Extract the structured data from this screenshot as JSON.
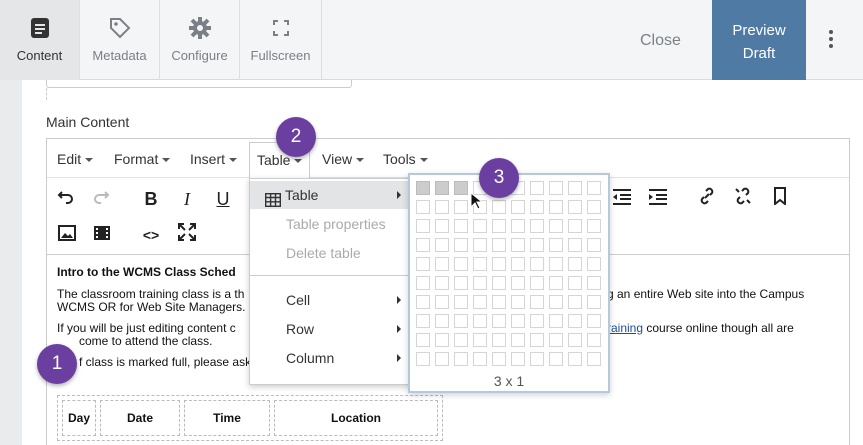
{
  "topbar": {
    "tabs": [
      {
        "label": "Content",
        "icon": "document-icon"
      },
      {
        "label": "Metadata",
        "icon": "tag-icon"
      },
      {
        "label": "Configure",
        "icon": "gear-icon"
      },
      {
        "label": "Fullscreen",
        "icon": "fullscreen-icon"
      }
    ],
    "close_label": "Close",
    "preview_label": "Preview Draft"
  },
  "colors": {
    "accent": "#4f7aa3",
    "callout": "#6b3fa0",
    "highlight": "#e2e4e6"
  },
  "editor": {
    "section_label": "Main Content",
    "menus": [
      "Edit",
      "Format",
      "Insert",
      "Table",
      "View",
      "Tools"
    ],
    "content": {
      "heading": "Intro to the WCMS Class Sched",
      "line1a": "The classroom training class is a th",
      "line1b": "g an entire Web site into the Campus",
      "line2": "WCMS OR for Web Site Managers.",
      "line3a": "If you will be just editing content c",
      "link": "r Training",
      "line3b": " course online though all are",
      "line4": "come to attend the class.",
      "line5": "f class is marked full, please ask to be put on the waiting lis"
    },
    "table_headers": [
      "Day",
      "Date",
      "Time",
      "Location"
    ]
  },
  "table_menu": {
    "items": [
      {
        "label": "Table",
        "state": "highlighted",
        "submenu": true
      },
      {
        "label": "Table properties",
        "state": "disabled",
        "submenu": false
      },
      {
        "label": "Delete table",
        "state": "disabled",
        "submenu": false
      },
      {
        "label": "Cell",
        "state": "normal",
        "submenu": true
      },
      {
        "label": "Row",
        "state": "normal",
        "submenu": true
      },
      {
        "label": "Column",
        "state": "normal",
        "submenu": true
      }
    ]
  },
  "grid_picker": {
    "rows": 10,
    "cols": 10,
    "selected_cols": 3,
    "selected_rows": 1,
    "label": "3 x 1"
  },
  "callouts": [
    "1",
    "2",
    "3"
  ]
}
